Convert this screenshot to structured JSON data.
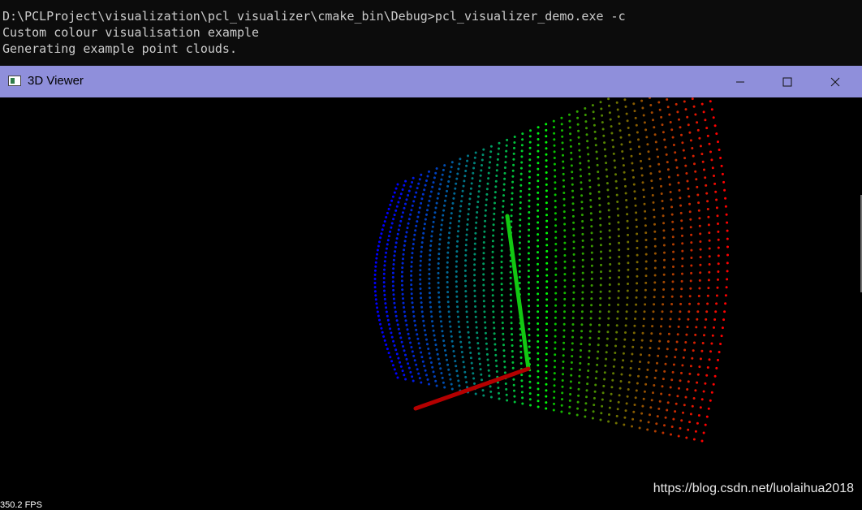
{
  "console": {
    "lines": [
      "D:\\PCLProject\\visualization\\pcl_visualizer\\cmake_bin\\Debug>pcl_visualizer_demo.exe -c",
      "Custom colour visualisation example",
      "Generating example point clouds."
    ]
  },
  "window": {
    "title": "3D Viewer",
    "controls": {
      "minimize": "minimize-icon",
      "maximize": "maximize-icon",
      "close": "close-icon"
    }
  },
  "viewport": {
    "fps_text": "350.2 FPS",
    "watermark": "https://blog.csdn.net/luolaihua2018",
    "background": "#000000",
    "axes": {
      "x_color": "#c00000",
      "y_color": "#00c000"
    },
    "cloud_color_scale": [
      "#0000ff",
      "#00ff00",
      "#ff0000"
    ]
  }
}
